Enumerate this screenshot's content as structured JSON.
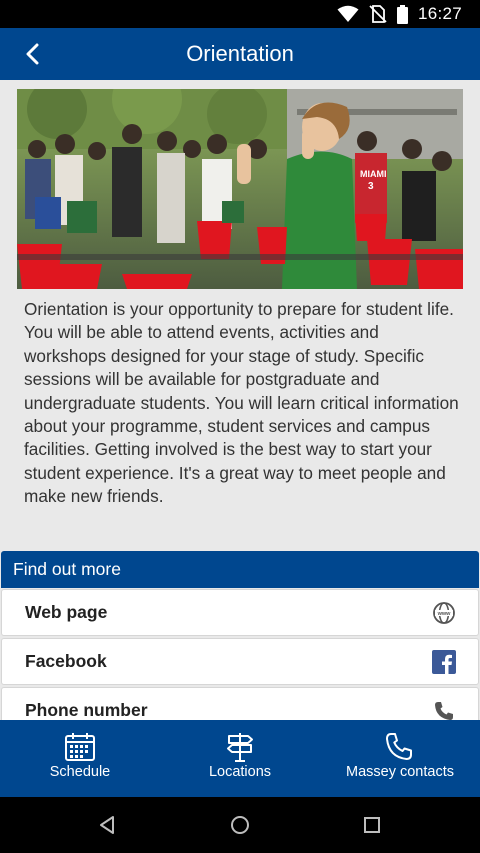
{
  "status_bar": {
    "time": "16:27",
    "icons": [
      "wifi-icon",
      "no-sim-icon",
      "battery-icon"
    ]
  },
  "app_bar": {
    "title": "Orientation",
    "back_icon": "back-arrow-icon"
  },
  "hero": {
    "shirt_text": "MIAMI",
    "shirt_number": "3"
  },
  "description": "Orientation is your opportunity to prepare for student life. You will be able to attend events, activities and workshops designed for your stage of study. Specific sessions will be available for postgraduate and undergraduate students. You will learn critical information about your programme, student services and campus facilities. Getting involved is the best way to start your student experience. It's a great way to meet people and make new friends.",
  "find_out_more": {
    "header": "Find out more",
    "items": [
      {
        "label": "Web page",
        "icon": "globe-icon"
      },
      {
        "label": "Facebook",
        "icon": "facebook-icon"
      },
      {
        "label": "Phone number",
        "icon": "phone-icon"
      }
    ]
  },
  "bottom_nav": {
    "items": [
      {
        "label": "Schedule",
        "icon": "calendar-icon"
      },
      {
        "label": "Locations",
        "icon": "signpost-icon"
      },
      {
        "label": "Massey contacts",
        "icon": "phone-icon"
      }
    ]
  },
  "system_nav": {
    "icons": [
      "back-triangle-icon",
      "home-circle-icon",
      "recents-square-icon"
    ]
  },
  "colors": {
    "primary": "#00478f",
    "background": "#e9e9e9",
    "facebook": "#3b5998"
  }
}
